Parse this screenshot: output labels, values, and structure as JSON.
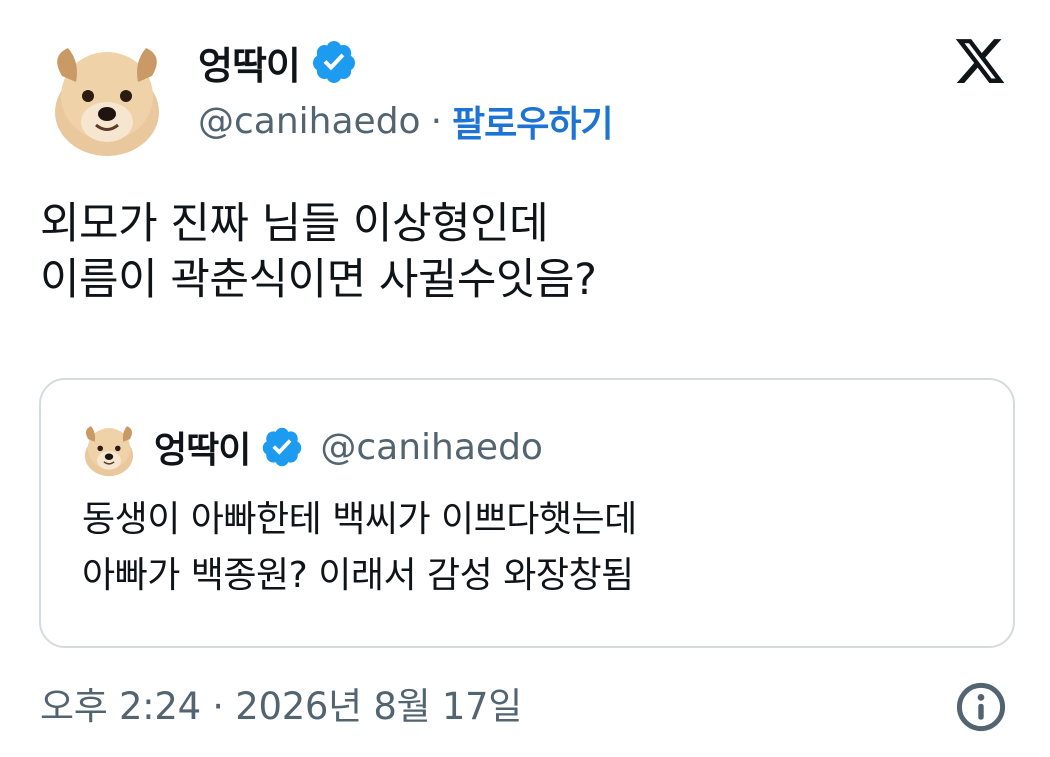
{
  "author": {
    "display_name": "엉딱이",
    "handle": "@canihaedo",
    "separator": "·",
    "follow_label": "팔로우하기",
    "verified_color": "#1d9bf0"
  },
  "tweet": {
    "lines": [
      "외모가 진짜 님들 이상형인데",
      "이름이 곽춘식이면 사귈수잇음?"
    ]
  },
  "quoted_tweet": {
    "display_name": "엉딱이",
    "handle": "@canihaedo",
    "lines": [
      "동생이 아빠한테 백씨가 이쁘다햇는데",
      "아빠가 백종원? 이래서 감성 와장창됨"
    ]
  },
  "footer": {
    "timestamp": "오후 2:24 · 2026년 8월 17일",
    "info_icon": "info-icon"
  },
  "brand": {
    "logo": "x-logo",
    "link_color": "#1d74d4",
    "muted_color": "#536471"
  }
}
